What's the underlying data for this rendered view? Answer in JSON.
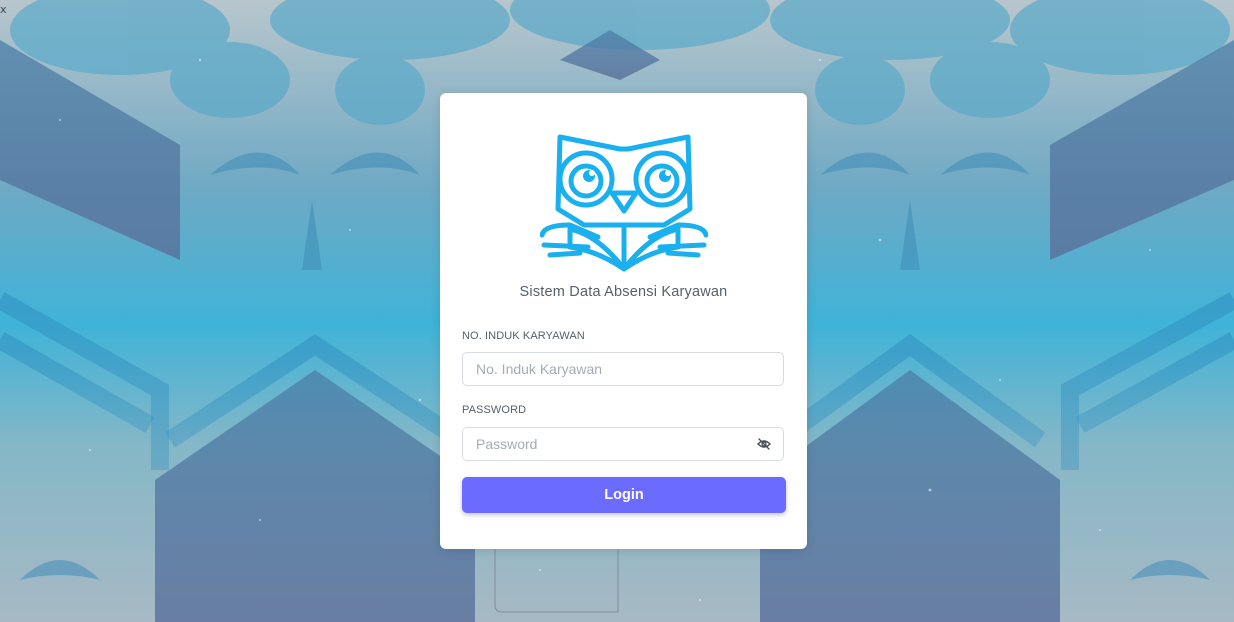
{
  "corner_text": "x",
  "app": {
    "title": "Sistem Data Absensi Karyawan",
    "logo_icon": "owl-reading-book-icon",
    "logo_color": "#1ab0f0"
  },
  "form": {
    "nik_label": "NO. INDUK KARYAWAN",
    "nik_placeholder": "No. Induk Karyawan",
    "nik_value": "",
    "password_label": "PASSWORD",
    "password_placeholder": "Password",
    "password_value": "",
    "password_toggle_icon": "eye-off-icon",
    "login_label": "Login"
  },
  "colors": {
    "accent": "#6b6bff",
    "card": "#ffffff"
  }
}
